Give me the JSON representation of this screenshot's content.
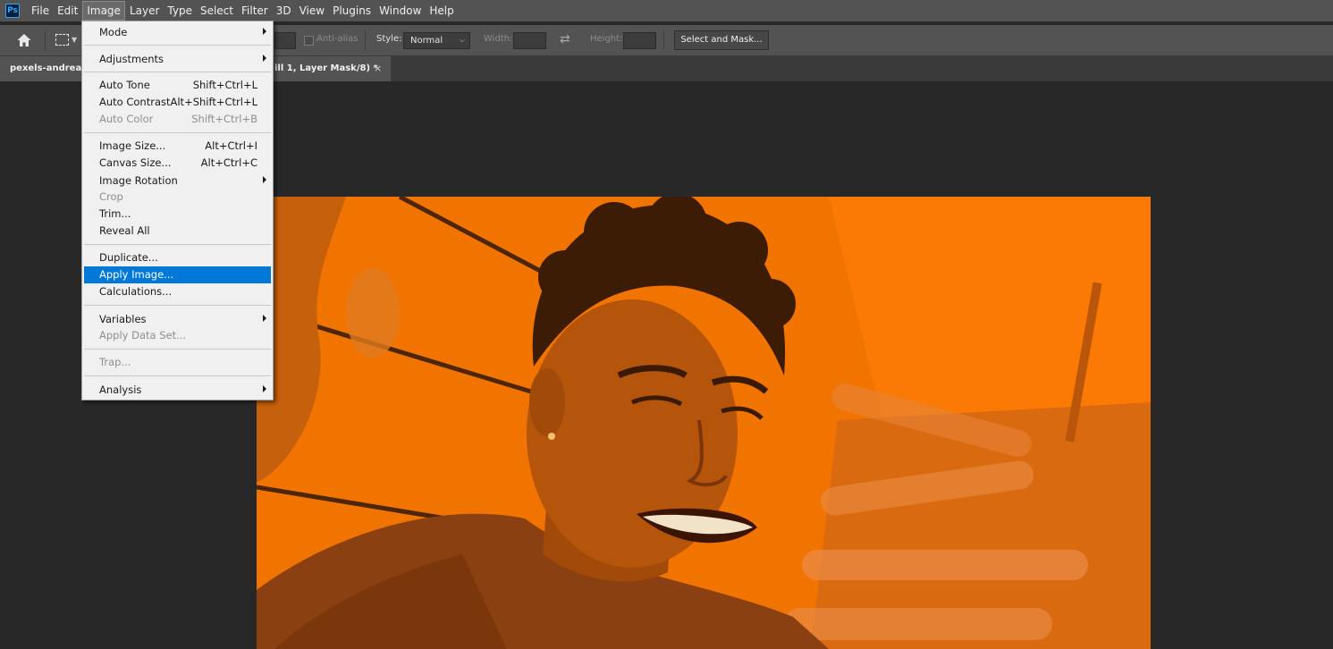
{
  "app": {
    "logo_text": "Ps"
  },
  "menubar": {
    "items": [
      {
        "label": "File"
      },
      {
        "label": "Edit"
      },
      {
        "label": "Image"
      },
      {
        "label": "Layer"
      },
      {
        "label": "Type"
      },
      {
        "label": "Select"
      },
      {
        "label": "Filter"
      },
      {
        "label": "3D"
      },
      {
        "label": "View"
      },
      {
        "label": "Plugins"
      },
      {
        "label": "Window"
      },
      {
        "label": "Help"
      }
    ],
    "active": "Image"
  },
  "options": {
    "anti_alias_label": "Anti-alias",
    "style_label": "Style:",
    "style_value": "Normal",
    "width_label": "Width:",
    "height_label": "Height:",
    "select_and_mask": "Select and Mask..."
  },
  "tab": {
    "title_left": "pexels-andrea-p",
    "title_right": "ill 1, Layer Mask/8) *",
    "close": "×"
  },
  "image_menu": {
    "items": [
      {
        "label": "Mode",
        "shortcut": "",
        "submenu": true,
        "disabled": false
      },
      {
        "label": "Adjustments",
        "shortcut": "",
        "submenu": true,
        "disabled": false
      },
      {
        "label": "Auto Tone",
        "shortcut": "Shift+Ctrl+L",
        "submenu": false,
        "disabled": false
      },
      {
        "label": "Auto Contrast",
        "shortcut": "Alt+Shift+Ctrl+L",
        "submenu": false,
        "disabled": false
      },
      {
        "label": "Auto Color",
        "shortcut": "Shift+Ctrl+B",
        "submenu": false,
        "disabled": true
      },
      {
        "label": "Image Size...",
        "shortcut": "Alt+Ctrl+I",
        "submenu": false,
        "disabled": false
      },
      {
        "label": "Canvas Size...",
        "shortcut": "Alt+Ctrl+C",
        "submenu": false,
        "disabled": false
      },
      {
        "label": "Image Rotation",
        "shortcut": "",
        "submenu": true,
        "disabled": false
      },
      {
        "label": "Crop",
        "shortcut": "",
        "submenu": false,
        "disabled": true
      },
      {
        "label": "Trim...",
        "shortcut": "",
        "submenu": false,
        "disabled": false
      },
      {
        "label": "Reveal All",
        "shortcut": "",
        "submenu": false,
        "disabled": false
      },
      {
        "label": "Duplicate...",
        "shortcut": "",
        "submenu": false,
        "disabled": false
      },
      {
        "label": "Apply Image...",
        "shortcut": "",
        "submenu": false,
        "disabled": false,
        "highlighted": true
      },
      {
        "label": "Calculations...",
        "shortcut": "",
        "submenu": false,
        "disabled": false
      },
      {
        "label": "Variables",
        "shortcut": "",
        "submenu": true,
        "disabled": false
      },
      {
        "label": "Apply Data Set...",
        "shortcut": "",
        "submenu": false,
        "disabled": true
      },
      {
        "label": "Trap...",
        "shortcut": "",
        "submenu": false,
        "disabled": true
      },
      {
        "label": "Analysis",
        "shortcut": "",
        "submenu": true,
        "disabled": false
      }
    ]
  },
  "colors": {
    "ui_dark": "#282828",
    "ui_panel": "#535353",
    "menu_bg": "#f0f0f0",
    "menu_highlight": "#0078d7",
    "image_orange": "#f07300"
  }
}
